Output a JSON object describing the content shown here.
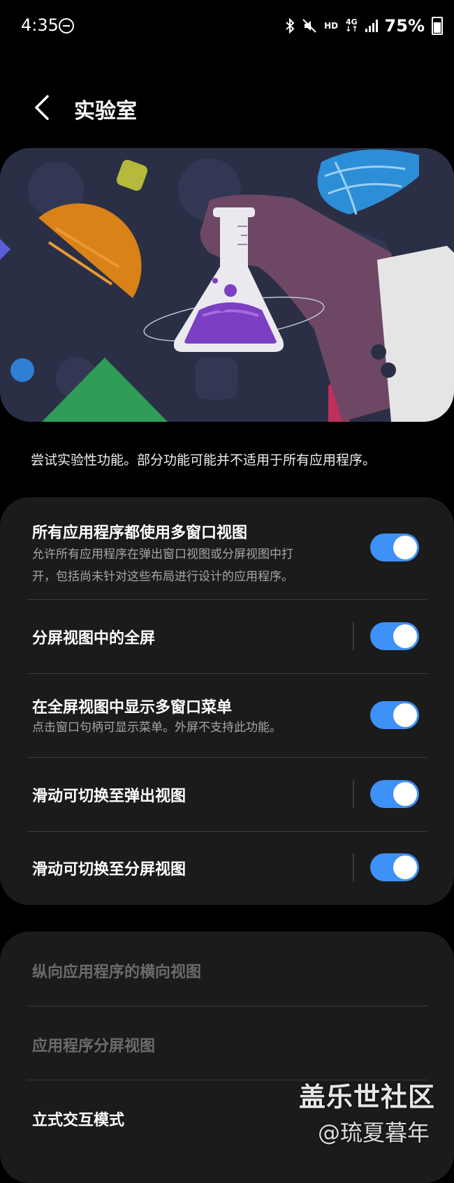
{
  "status_bar": {
    "time": "4:35",
    "hd": "HD",
    "net_top": "4G",
    "net_bottom": "↓↑",
    "battery": "75%"
  },
  "header": {
    "title": "实验室"
  },
  "description": "尝试实验性功能。部分功能可能并不适用于所有应用程序。",
  "section1": [
    {
      "title": "所有应用程序都使用多窗口视图",
      "subtitle": "允许所有应用程序在弹出窗口视图或分屏视图中打\n开，包括尚未针对这些布局进行设计的应用程序。",
      "on": true
    },
    {
      "title": "分屏视图中的全屏",
      "on": true
    },
    {
      "title": "在全屏视图中显示多窗口菜单",
      "subtitle": "点击窗口句柄可显示菜单。外屏不支持此功能。",
      "on": true
    },
    {
      "title": "滑动可切换至弹出视图",
      "on": true
    },
    {
      "title": "滑动可切换至分屏视图",
      "on": true
    }
  ],
  "section2": [
    {
      "title": "纵向应用程序的横向视图",
      "disabled": true
    },
    {
      "title": "应用程序分屏视图",
      "disabled": true
    },
    {
      "title": "立式交互模式",
      "disabled": false
    }
  ],
  "watermark": {
    "line1": "盖乐世社区",
    "line2": "@琉夏暮年"
  },
  "colors": {
    "toggle_on": "#3e91f7",
    "card_bg": "#1b1b1b",
    "background": "#000000"
  }
}
